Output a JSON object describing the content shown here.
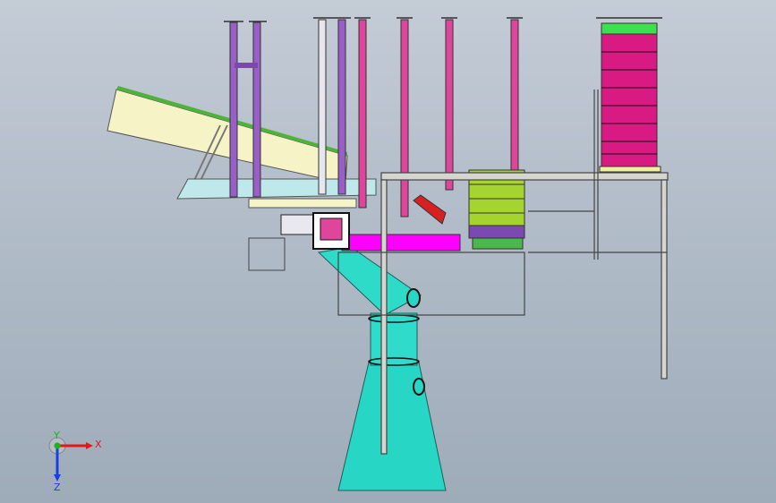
{
  "viewport": {
    "background_top": "#c4ccd6",
    "background_bottom": "#9eabb9"
  },
  "model": {
    "colors": {
      "pipe_magenta": "#e0459c",
      "pipe_purple": "#9a5fc6",
      "pipe_white": "#e6e6ee",
      "hopper_cyan": "#27d6c4",
      "conveyor_yellow": "#f6f4c6",
      "conveyor_green": "#4fb23a",
      "box_magenta": "#d81a82",
      "box_lime": "#a6d42e",
      "box_green_cap": "#3fe04f",
      "frame_grey": "#d6d6d0",
      "accent_magenta": "#ff00ff",
      "accent_red": "#d82020"
    }
  },
  "triad": {
    "x_label": "X",
    "y_label": "Y",
    "z_label": "Z",
    "x_color": "#e01a1a",
    "y_color": "#1ab31a",
    "z_color": "#1a3fe0"
  }
}
